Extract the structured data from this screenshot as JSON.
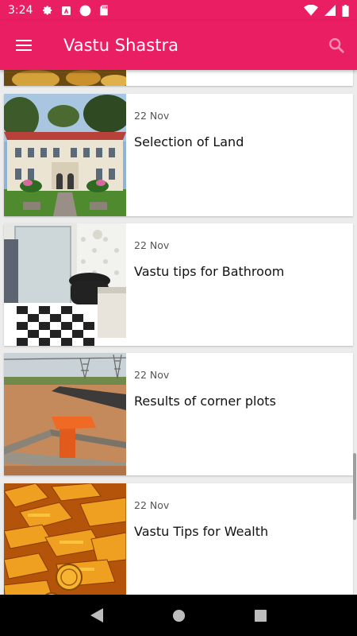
{
  "status_bar": {
    "time": "3:24"
  },
  "app_bar": {
    "title": "Vastu Shastra"
  },
  "articles": [
    {
      "date": "22 Nov",
      "title": "Selection of Land"
    },
    {
      "date": "22 Nov",
      "title": "Vastu tips for Bathroom"
    },
    {
      "date": "22 Nov",
      "title": "Results of corner plots"
    },
    {
      "date": "22 Nov",
      "title": "Vastu Tips for Wealth"
    }
  ],
  "colors": {
    "primary": "#e91e63",
    "search_icon": "#f48fb1"
  }
}
